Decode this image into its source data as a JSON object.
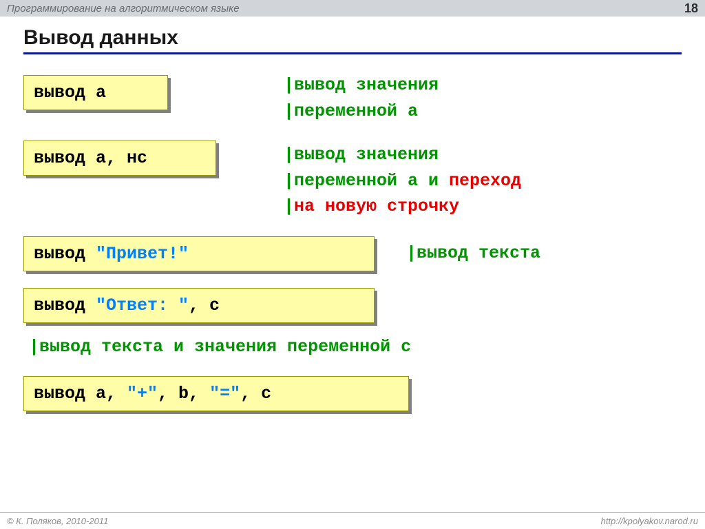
{
  "header": {
    "title": "Программирование на алгоритмическом языке",
    "page": "18"
  },
  "slide_title": "Вывод данных",
  "rows": {
    "r1_code": "вывод a",
    "r1_a_l1": "|вывод значения",
    "r1_a_l2": "|переменной a",
    "r2_code": "вывод a, нс",
    "r2_a_l1": "|вывод значения",
    "r2_a_l2a": "|переменной a и ",
    "r2_a_l2b": "переход",
    "r2_a_l3a": "|",
    "r2_a_l3b": "на новую строчку",
    "r3_c1": "вывод ",
    "r3_c2": "\"Привет!\"",
    "r3_a": "|вывод текста",
    "r4_c1": "вывод ",
    "r4_c2": "\"Ответ: \"",
    "r4_c3": ", c",
    "r4_a": "|вывод текста и значения переменной c",
    "r5_c1": "вывод a, ",
    "r5_c2": "\"+\"",
    "r5_c3": ", b, ",
    "r5_c4": "\"=\"",
    "r5_c5": ", c"
  },
  "footer": {
    "left": "© К. Поляков, 2010-2011",
    "right": "http://kpolyakov.narod.ru"
  }
}
